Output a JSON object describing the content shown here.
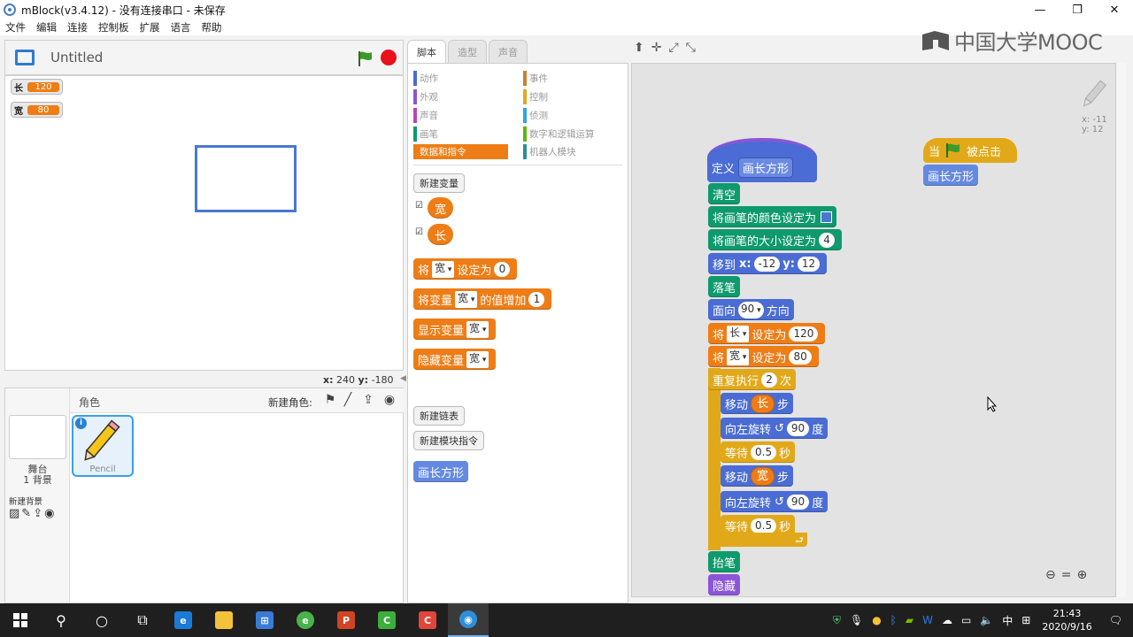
{
  "window": {
    "title": "mBlock(v3.4.12) - 没有连接串口 - 未保存",
    "minimize": "—",
    "maximize": "❐",
    "close": "✕"
  },
  "menu": [
    "文件",
    "编辑",
    "连接",
    "控制板",
    "扩展",
    "语言",
    "帮助"
  ],
  "watermark": "中国大学MOOC",
  "stage": {
    "title": "Untitled",
    "monitors": [
      {
        "name": "长",
        "value": "120"
      },
      {
        "name": "宽",
        "value": "80"
      }
    ],
    "coords": {
      "x_label": "x:",
      "x": "240",
      "y_label": "y:",
      "y": "-180"
    }
  },
  "sprites_panel": {
    "header": "角色",
    "new_sprite": "新建角色:",
    "stage_label": "舞台",
    "backdrop_count": "1 背景",
    "new_backdrop": "新建背景",
    "sprite_name": "Pencil",
    "info": "i"
  },
  "tabs": [
    "脚本",
    "造型",
    "声音"
  ],
  "categories": {
    "left": [
      {
        "label": "动作",
        "color": "#4a6cd4"
      },
      {
        "label": "外观",
        "color": "#8a55d7"
      },
      {
        "label": "声音",
        "color": "#bb42c3"
      },
      {
        "label": "画笔",
        "color": "#0e9a6c"
      },
      {
        "label": "数据和指令",
        "color": "#ee7d16"
      }
    ],
    "right": [
      {
        "label": "事件",
        "color": "#c88330"
      },
      {
        "label": "控制",
        "color": "#e1a91a"
      },
      {
        "label": "侦测",
        "color": "#2ca5e2"
      },
      {
        "label": "数字和逻辑运算",
        "color": "#5cb712"
      },
      {
        "label": "机器人模块",
        "color": "#2a8f99"
      }
    ]
  },
  "palette": {
    "new_variable": "新建变量",
    "variables": [
      "宽",
      "长"
    ],
    "checkmark": "☑",
    "set_block": {
      "pre": "将",
      "var": "宽",
      "mid": "设定为",
      "val": "0"
    },
    "change_block": {
      "pre": "将变量",
      "var": "宽",
      "mid": "的值增加",
      "val": "1"
    },
    "show_block": {
      "pre": "显示变量",
      "var": "宽"
    },
    "hide_block": {
      "pre": "隐藏变量",
      "var": "宽"
    },
    "new_list": "新建链表",
    "new_block": "新建模块指令",
    "custom_block": "画长方形"
  },
  "script": {
    "define": {
      "label": "定义",
      "name": "画长方形"
    },
    "clear": "清空",
    "pen_color": "将画笔的颜色设定为",
    "pen_color_value": "#4a78d0",
    "pen_size": {
      "label": "将画笔的大小设定为",
      "val": "4"
    },
    "goto": {
      "label": "移到",
      "x_label": "x:",
      "x": "-12",
      "y_label": "y:",
      "y": "12"
    },
    "pen_down": "落笔",
    "point": {
      "label": "面向",
      "val": "90",
      "suffix": "方向"
    },
    "set_len": {
      "pre": "将",
      "var": "长",
      "mid": "设定为",
      "val": "120"
    },
    "set_wid": {
      "pre": "将",
      "var": "宽",
      "mid": "设定为",
      "val": "80"
    },
    "repeat": {
      "label": "重复执行",
      "val": "2",
      "suffix": "次"
    },
    "move1": {
      "label": "移动",
      "var": "长",
      "suffix": "步"
    },
    "turn1": {
      "label": "向左旋转",
      "arrow": "↺",
      "val": "90",
      "suffix": "度"
    },
    "wait1": {
      "label": "等待",
      "val": "0.5",
      "suffix": "秒"
    },
    "move2": {
      "label": "移动",
      "var": "宽",
      "suffix": "步"
    },
    "turn2": {
      "label": "向左旋转",
      "arrow": "↺",
      "val": "90",
      "suffix": "度"
    },
    "wait2": {
      "label": "等待",
      "val": "0.5",
      "suffix": "秒"
    },
    "pen_up": "抬笔",
    "hide": "隐藏",
    "when_flag": {
      "pre": "当",
      "post": "被点击"
    },
    "call": "画长方形",
    "sprite_pos": {
      "x": "x: -11",
      "y": "y: 12"
    },
    "repeat_end": "⮐"
  },
  "taskbar": {
    "time": "21:43",
    "date": "2020/9/16",
    "ime": "中"
  }
}
